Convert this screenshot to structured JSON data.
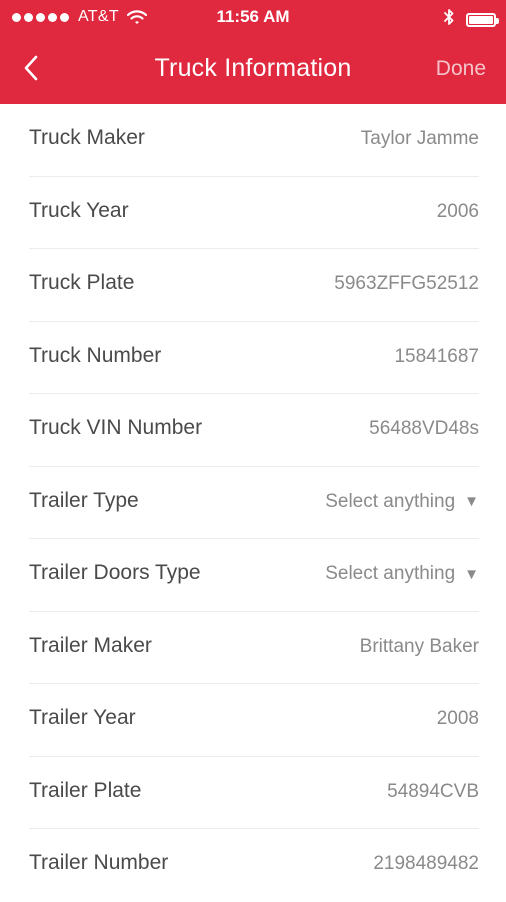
{
  "status_bar": {
    "carrier": "AT&T",
    "time": "11:56 AM",
    "signal_icon": "signal-dots-icon",
    "wifi_icon": "wifi-icon",
    "bluetooth_icon": "bluetooth-icon",
    "battery_icon": "battery-icon",
    "battery_level": 1.0
  },
  "nav": {
    "title": "Truck Information",
    "back_icon": "chevron-left-icon",
    "done_label": "Done"
  },
  "colors": {
    "brand": "#e0283f",
    "label_text": "#4a4a4a",
    "value_text": "#8a8a8a",
    "divider": "#ececec"
  },
  "rows": [
    {
      "label": "Truck Maker",
      "value": "Taylor Jamme",
      "dropdown": false
    },
    {
      "label": "Truck Year",
      "value": "2006",
      "dropdown": false
    },
    {
      "label": "Truck Plate",
      "value": "5963ZFFG52512",
      "dropdown": false
    },
    {
      "label": "Truck Number",
      "value": "15841687",
      "dropdown": false
    },
    {
      "label": "Truck VIN Number",
      "value": "56488VD48s",
      "dropdown": false
    },
    {
      "label": "Trailer Type",
      "value": "Select anything",
      "dropdown": true,
      "caret": "▼"
    },
    {
      "label": "Trailer Doors Type",
      "value": "Select anything",
      "dropdown": true,
      "caret": "▼"
    },
    {
      "label": "Trailer Maker",
      "value": "Brittany Baker",
      "dropdown": false
    },
    {
      "label": "Trailer Year",
      "value": "2008",
      "dropdown": false
    },
    {
      "label": "Trailer Plate",
      "value": "54894CVB",
      "dropdown": false
    },
    {
      "label": "Trailer Number",
      "value": "2198489482",
      "dropdown": false
    }
  ]
}
